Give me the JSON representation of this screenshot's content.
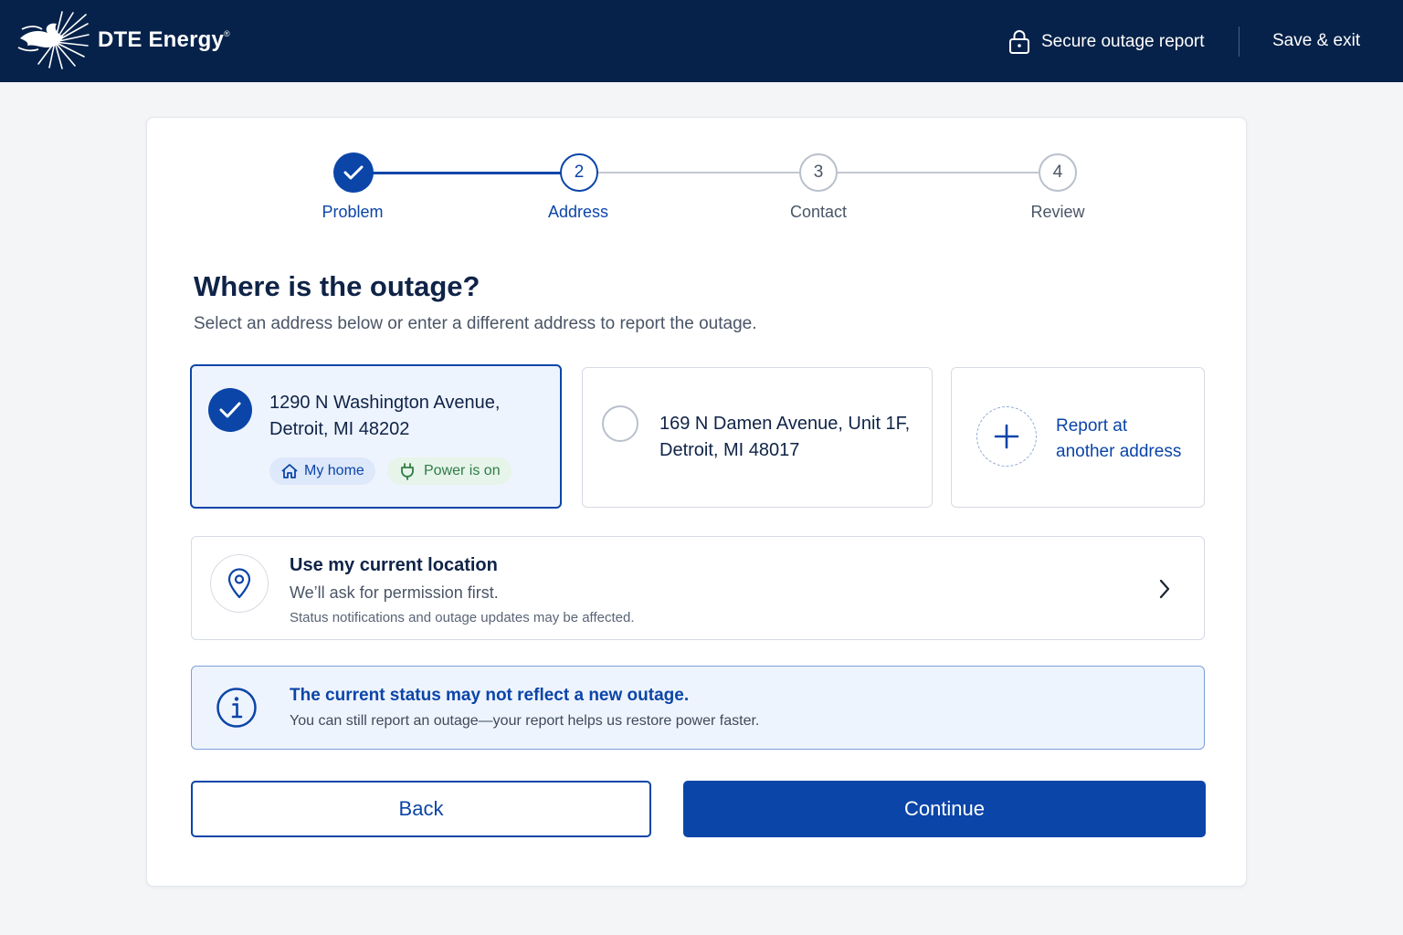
{
  "header": {
    "brand": "DTE Energy",
    "brand_mark": "®",
    "secure_label": "Secure outage report",
    "save_exit_label": "Save & exit"
  },
  "stepper": {
    "steps": [
      {
        "number": "1",
        "label": "Problem",
        "state": "complete"
      },
      {
        "number": "2",
        "label": "Address",
        "state": "current"
      },
      {
        "number": "3",
        "label": "Contact",
        "state": "upcoming"
      },
      {
        "number": "4",
        "label": "Review",
        "state": "upcoming"
      }
    ]
  },
  "main": {
    "title": "Where is the outage?",
    "subtitle": "Select an address below or enter a different address to report the outage."
  },
  "addresses": [
    {
      "line1": "1290 N Washington Avenue,",
      "line2": "Detroit, MI 48202",
      "selected": true,
      "tag_home": "My home",
      "tag_power": "Power is on"
    },
    {
      "line1": "169 N Damen Avenue, Unit 1F,",
      "line2": "Detroit, MI 48017",
      "selected": false
    }
  ],
  "report_other": {
    "line1": "Report at",
    "line2": "another address"
  },
  "location": {
    "title": "Use my current location",
    "subtitle": "We’ll ask for permission first.",
    "note": "Status notifications and outage updates may be affected."
  },
  "info": {
    "title": "The current status may not reflect a new outage.",
    "body": "You can still report an outage—your report helps us restore power faster."
  },
  "actions": {
    "back": "Back",
    "continue": "Continue"
  },
  "colors": {
    "navy": "#06224a",
    "primary": "#0b45a8",
    "success": "#2f7d46",
    "success_bg": "#e6f4ea"
  }
}
